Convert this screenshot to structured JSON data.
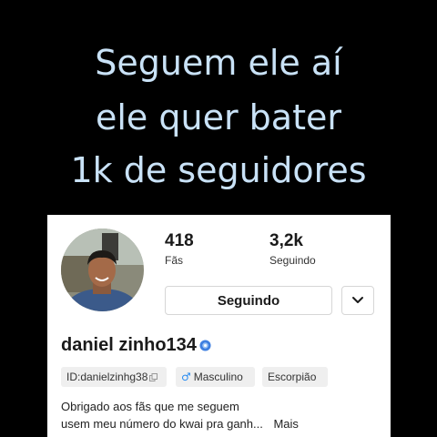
{
  "caption": {
    "line1": "Seguem ele aí",
    "line2": "ele quer bater",
    "line3": "1k de seguidores"
  },
  "profile": {
    "stats": [
      {
        "value": "418",
        "label": "Fãs"
      },
      {
        "value": "3,2k",
        "label": "Seguindo"
      }
    ],
    "follow_button_label": "Seguindo",
    "more_icon": "chevron-down-icon",
    "username": "daniel zinho134",
    "verified_icon": "verified-badge-icon",
    "tags": {
      "id": "ID:danielzinhg38",
      "copy_icon": "copy-icon",
      "gender_symbol": "♂",
      "gender": "Masculino",
      "zodiac": "Escorpião"
    },
    "bio_line1": "Obrigado aos fãs que me seguem",
    "bio_line2": "usem meu número do kwai pra ganh...",
    "bio_more": "Mais"
  },
  "colors": {
    "caption_text": "#c9e2f7",
    "background": "#000000",
    "card": "#ffffff",
    "gender_icon": "#2a8cf0",
    "verified_badge": "#3f7fe0"
  }
}
